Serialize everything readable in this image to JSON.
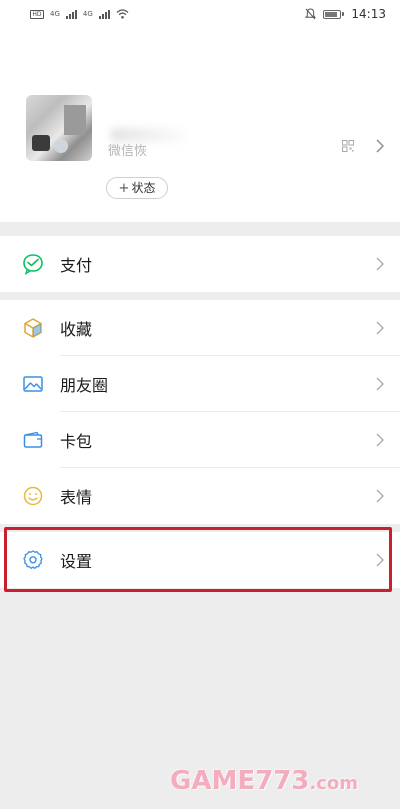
{
  "status_bar": {
    "sim_label": "HD",
    "net_left": "4G",
    "net_right": "4G",
    "time": "14:13"
  },
  "profile": {
    "wechat_id_label": "微信恢",
    "status_button_label": "状态"
  },
  "menu_groups": [
    {
      "items": [
        {
          "label": "支付",
          "icon": "pay-icon"
        }
      ]
    },
    {
      "items": [
        {
          "label": "收藏",
          "icon": "favorites-icon"
        },
        {
          "label": "朋友圈",
          "icon": "moments-icon"
        },
        {
          "label": "卡包",
          "icon": "card-wallet-icon"
        },
        {
          "label": "表情",
          "icon": "sticker-icon"
        }
      ]
    },
    {
      "items": [
        {
          "label": "设置",
          "icon": "settings-icon"
        }
      ]
    }
  ],
  "colors": {
    "accent_green": "#07c160",
    "highlight_red": "#c8202e",
    "background": "#ededed"
  },
  "watermark": {
    "text": "GAME773",
    "suffix": ".com"
  }
}
